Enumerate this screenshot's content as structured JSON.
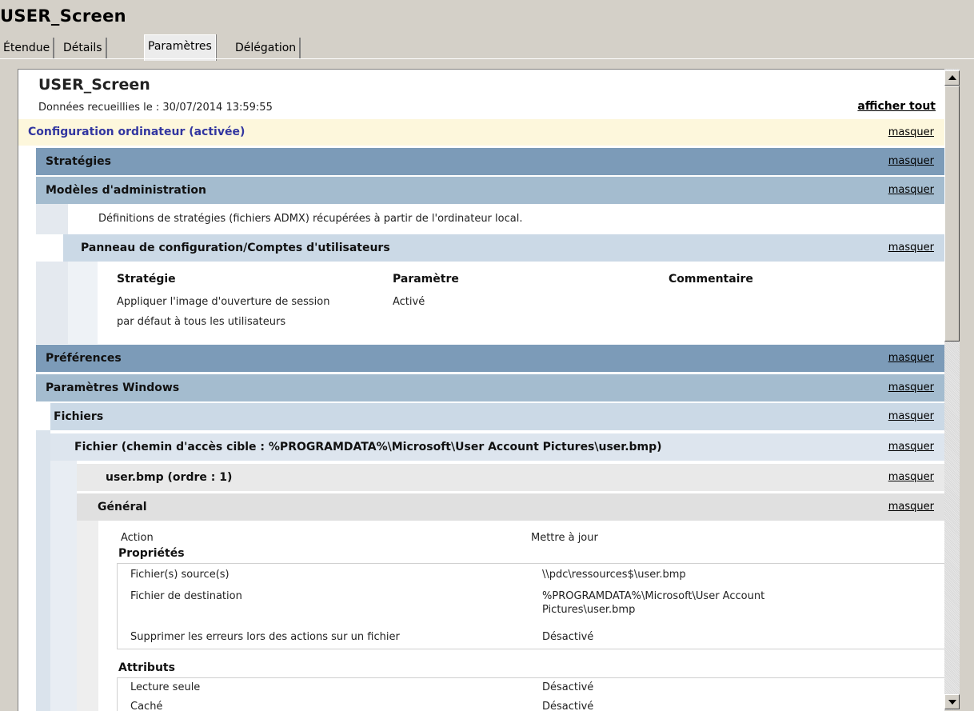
{
  "window": {
    "title": "USER_Screen"
  },
  "tabs": [
    {
      "label": "Étendue"
    },
    {
      "label": "Détails"
    },
    {
      "label": "Paramètres"
    },
    {
      "label": "Délégation"
    }
  ],
  "report": {
    "title": "USER_Screen",
    "collected": "Données recueillies le : 30/07/2014 13:59:55",
    "show_all": "afficher tout",
    "hide_label": "masquer",
    "computer_config": "Configuration ordinateur (activée)",
    "policies": "Stratégies",
    "admin_templates": "Modèles d'administration",
    "admx_note": "Définitions de stratégies (fichiers ADMX) récupérées à partir de l'ordinateur local.",
    "control_panel": "Panneau de configuration/Comptes d'utilisateurs",
    "policy_table": {
      "headers": [
        "Stratégie",
        "Paramètre",
        "Commentaire"
      ],
      "rows": [
        {
          "policy_line1": "Appliquer l'image d'ouverture de session",
          "policy_line2": "par défaut à tous les utilisateurs",
          "setting": "Activé",
          "comment": ""
        }
      ]
    },
    "preferences": "Préférences",
    "windows_settings": "Paramètres Windows",
    "files": "Fichiers",
    "file_item": "Fichier (chemin d'accès cible : %PROGRAMDATA%\\Microsoft\\User Account Pictures\\user.bmp)",
    "user_bmp": "user.bmp (ordre : 1)",
    "general": "Général",
    "general_items": {
      "action_label": "Action",
      "action_value": "Mettre à jour",
      "properties_heading": "Propriétés",
      "props": [
        {
          "label": "Fichier(s) source(s)",
          "value": "\\\\pdc\\ressources$\\user.bmp"
        },
        {
          "label": "Fichier de destination",
          "value_line1": "%PROGRAMDATA%\\Microsoft\\User Account",
          "value_line2": "Pictures\\user.bmp"
        },
        {
          "label": "Supprimer les erreurs lors des actions sur un fichier",
          "value": "Désactivé"
        }
      ],
      "attributes_heading": "Attributs",
      "attrs": [
        {
          "label": "Lecture seule",
          "value": "Désactivé"
        },
        {
          "label": "Caché",
          "value": "Désactivé"
        }
      ]
    }
  }
}
